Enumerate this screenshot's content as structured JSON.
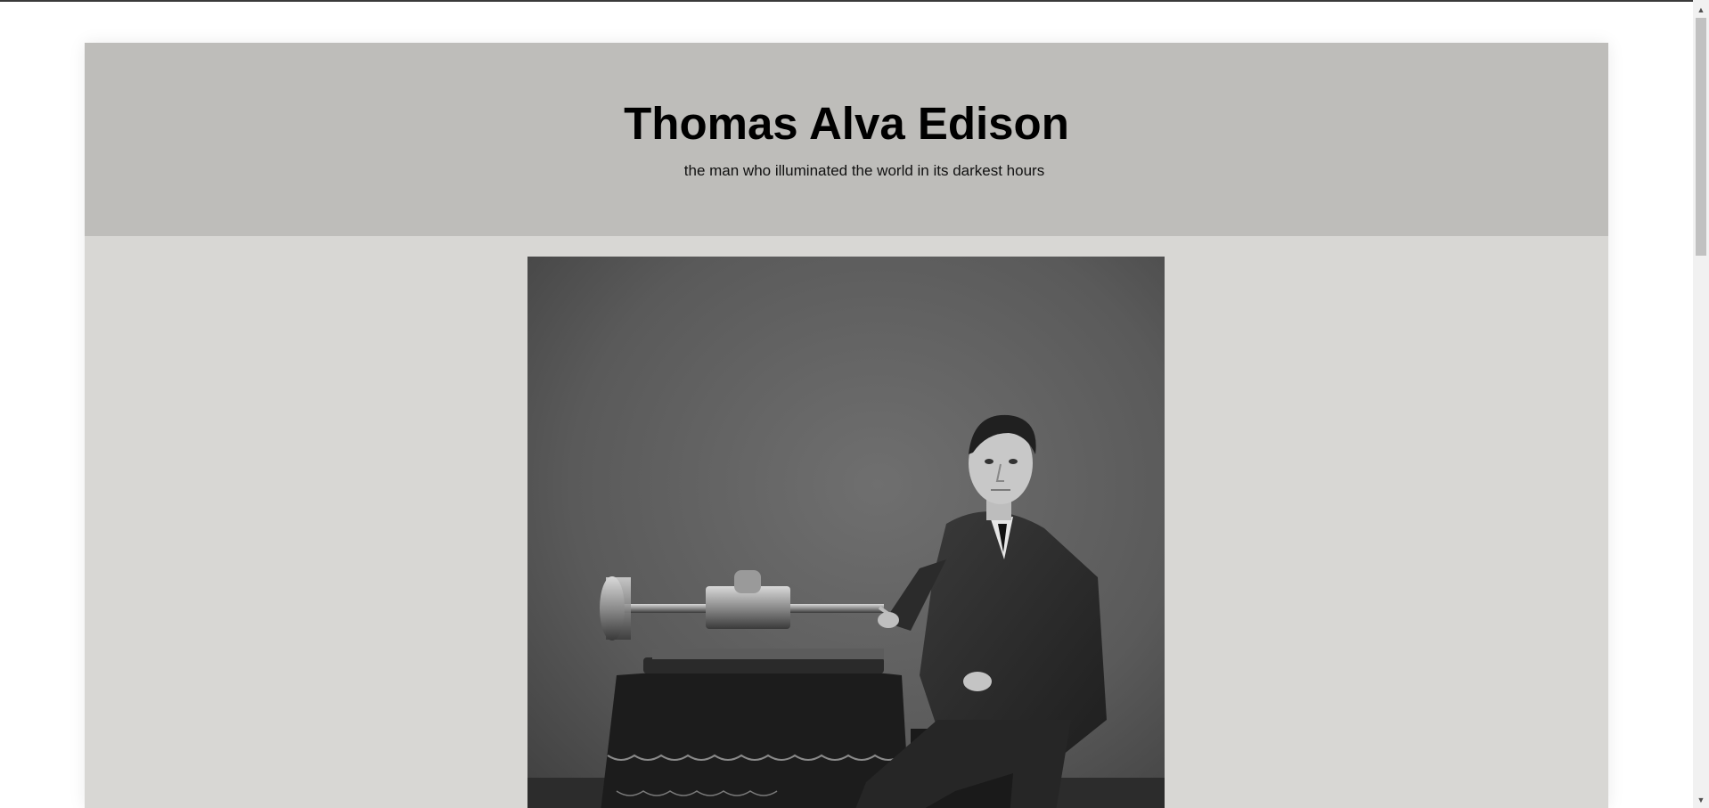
{
  "header": {
    "title": "Thomas Alva Edison",
    "subtitle": "the man who illuminated the world in its darkest hours"
  },
  "main": {
    "image": {
      "subject": "Edison seated beside phonograph photograph"
    }
  },
  "scrollbar": {
    "up_icon": "▲",
    "down_icon": "▼"
  },
  "colors": {
    "header_bg": "#bebdba",
    "content_bg": "#d8d7d4",
    "page_bg": "#ffffff"
  }
}
